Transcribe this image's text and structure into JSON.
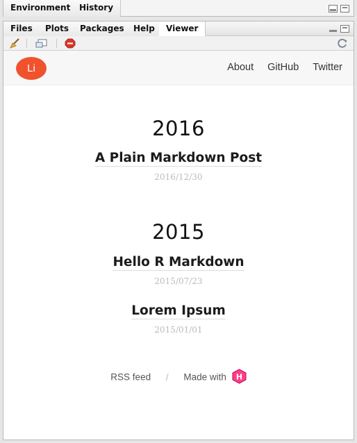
{
  "top_pane": {
    "tabs": [
      "Environment",
      "History"
    ]
  },
  "bottom_pane": {
    "tabs": [
      "Files",
      "Plots",
      "Packages",
      "Help",
      "Viewer"
    ],
    "active_tab": "Viewer"
  },
  "toolbar": {
    "icons": [
      "broom-icon",
      "export-window-icon",
      "stop-icon",
      "refresh-icon"
    ]
  },
  "site": {
    "logo_text": "Li",
    "logo_color": "#f0522d",
    "nav": [
      "About",
      "GitHub",
      "Twitter"
    ],
    "archive": [
      {
        "year": "2016",
        "posts": [
          {
            "title": "A Plain Markdown Post",
            "date": "2016/12/30"
          }
        ]
      },
      {
        "year": "2015",
        "posts": [
          {
            "title": "Hello R Markdown",
            "date": "2015/07/23"
          },
          {
            "title": "Lorem Ipsum",
            "date": "2015/01/01"
          }
        ]
      }
    ],
    "footer": {
      "rss": "RSS feed",
      "separator": "/",
      "made_with": "Made with",
      "hugo_icon_letter": "H",
      "hugo_icon_color": "#ff4088"
    }
  }
}
